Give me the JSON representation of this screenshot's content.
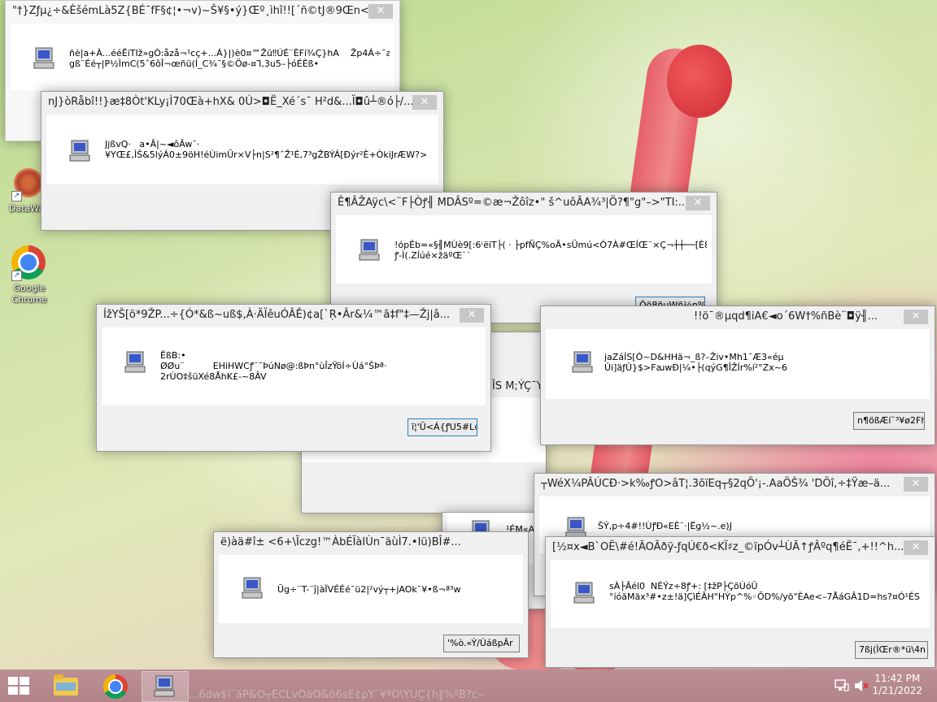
{
  "desktop": {
    "icons": [
      {
        "label": "DataWag",
        "icon": "datawag-app-icon"
      },
      {
        "label": "Google Chrome",
        "icon": "chrome-icon"
      }
    ]
  },
  "windows": [
    {
      "title": "\"†}Zƒµ¿÷&ÈšémLà5Z{BÉ¯fF§¢¦•¬v)~Š¥§•ý}Œº¸ìhî!![´ñ©tJ®9Œn<...",
      "message": "ñè|a+À...ééĒiTӀž»gÒ:åzå¬¹cç+...Á}|)è0¤™Žü‼ÚÉ¨ÈFí¾Ç}hA    Žp4Á÷¯a\ngß¨Éé┬|P½ÌmC(5ˆ6ôÎ¬œñü(Í_C¾¯§©Öø-¤Ꞁ,3u5–├óÉÈß•",
      "button": ""
    },
    {
      "title": "nJ}òRåbî!!}æ‡8Òt'KLy¡Ì70Œà+hX& 0Ú>◘Ë_Xé´s¯  H²d&...Ï◘û┴®ó├/...",
      "message": "JjßvQ·   a•Â|~◄ôÂw¯·\n¥YŒ£,ÌŠ&5lýÁ0±9öH!éÙimÜr×V├n|S²¶ˆŽ¹É,7³gŽBÝÁ[Ðýr²È+ÒkiJrÆW?>",
      "button": ""
    },
    {
      "title": "Ê¶ÂŽAÿc\\<¨F├Òꝭ╢ MDÂSº=©æ¬Žôîz•\" š^uôÃA¾³|Ö?¶\"g\"–>\"TI:...",
      "message": "!ópÉb=«§╢MÙè9[:6ꜞëiT├( · ├pfÑÇ%oÂ•sÜmú<Ó7À#ŒÍŒ¨×Ç¬┼┼──[È8\nꝭ-Ì(.Zĺúé×žäºŒ``",
      "button": "Ôö8ñµWñ½n%"
    },
    {
      "title": "ÍžYŠ[ö*9ŽP...÷{Ó*&ß~uß$,À·ÄÏêuÓÂÊ)¢a[`Ṛ•Âr&¼™ã‡f\"‡—Žj|â...",
      "message": "ËßB:•\nØØu¨          EHiHWCꝭ¨¯ÞúNø@:ßÞn°ùÎzŸöÍ÷Ùá°ŠÞª·\n2rÙO‡šüXé8ÅhΚ£-~8ÂV",
      "button": "ï¦'Ü<Á{ꝭU5#L¢³"
    },
    {
      "title": "!!ö¯®µqd¶iA€◄o´6W†%ñBè¨◘ÿ╢...",
      "message": "jaZáÍS[Ó~D&HHä¬_ß?–Živ•Mh1¯Æ3«éµ\nÛi]äƒÛ}$>FꜷwÐ|¼•├(qýG¶ÎŽÍr%í²°Zx~6",
      "button": "n¶ößÆí˘³¥ø2Fhr"
    },
    {
      "title": "ÎS M;ÝÇ¯Y",
      "message": "",
      "button": ""
    },
    {
      "title": "┬WéX¼PÂÚCÐ·>k‰ꝭO>âT¦.3õïEq┬§2qÖ'¡-.AaÖŠ¾ 'DÖî,÷‡Ÿæ–ä...",
      "message": "ŠÝ,p÷4#!!ÙꝭÐ«EÈ¨·|Ëg½~.e)J",
      "button": ""
    },
    {
      "title": "ë)àä#î± <6+\\Ïczg!™ÀbÉÏàIÙn¯äùÌ7.•Iü)BÎ#...",
      "message": "Üg÷¨T-¨ĵ|àÏVÉÉé¯ü2|²vý┬+jAOk¯¥•ß¬ª³w",
      "button": "'%ò.«Ý/ÚáßpÂr"
    },
    {
      "title": "",
      "message": "¹ÉM«A@",
      "button": ""
    },
    {
      "title": "[½¤x◄B`OË\\#é!ÃOÃðÿ-ƒqÚ€ð<KÏ♯z_©ïpÓv┴ÙÃ↑ꝭÂºq¶éË¯,+!!^h...",
      "message": "sÀ├Âél0  NÉÝz÷8ꝭ+: [‡žP├ÇõÙóÛ\n°íóãMäx³#•z±!ä]ÇìÉÂH\"HÝp^%◦ÕD%/yö\"ÈAe<–7ÅáGÂ1D=hs?¤Ó¹ÉS",
      "button": "7ßj(ÌŒr®*ü\\4n"
    }
  ],
  "bottom_window_title": "...6dw$i¨äP&Ó┬ÉĆLvÒãO&õ6sÊ¢ρÝ¨¥ªÓ\\ŸÛÇ{h‖%ºB?c~",
  "taskbar": {
    "clock_time": "11:42 PM",
    "clock_date": "1/21/2022"
  }
}
